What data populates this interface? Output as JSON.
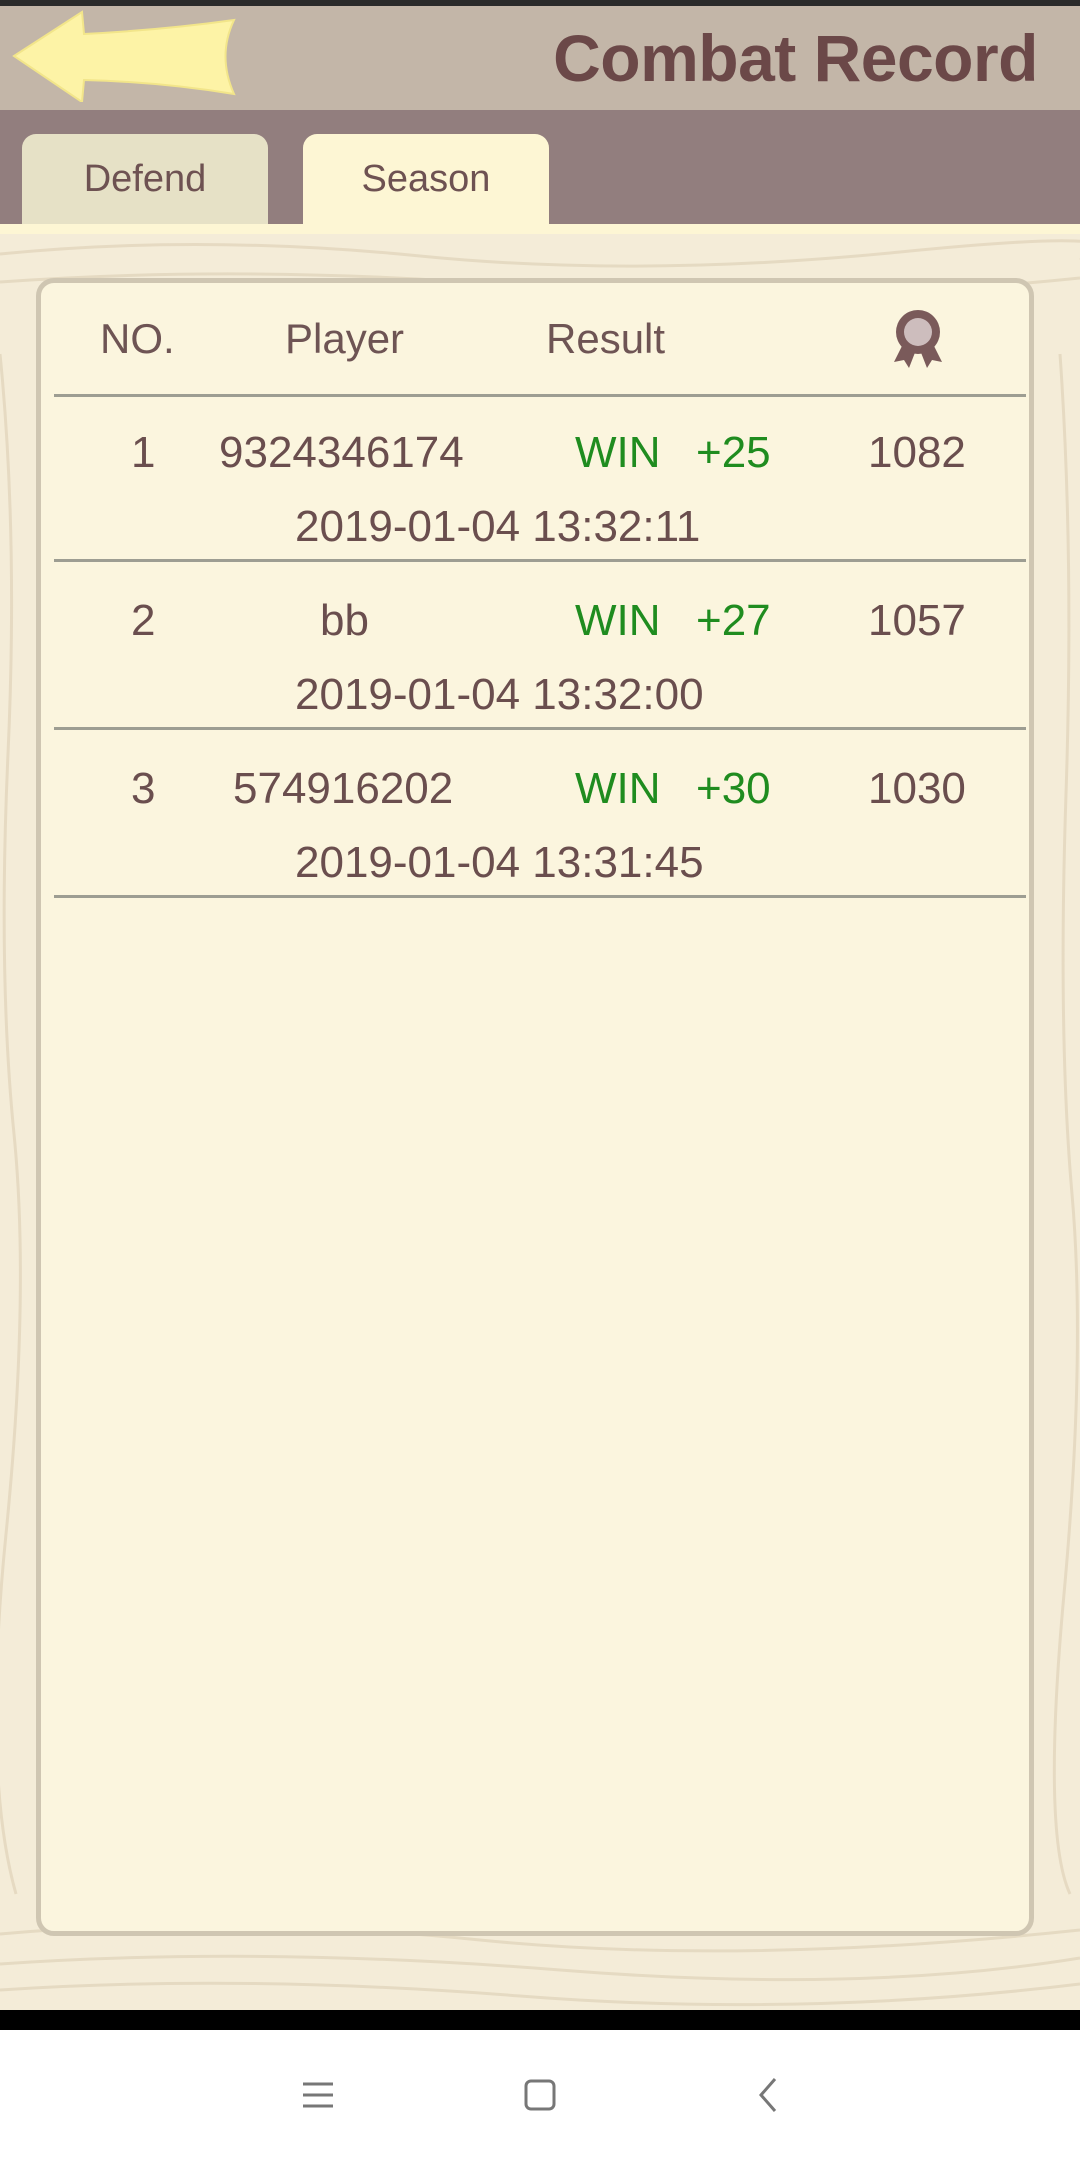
{
  "header": {
    "title": "Combat Record"
  },
  "tabs": [
    {
      "label": "Defend"
    },
    {
      "label": "Season"
    }
  ],
  "table": {
    "columns": [
      "NO.",
      "Player",
      "Result"
    ],
    "rank_column_icon": "medal-icon",
    "rows": [
      {
        "no": "1",
        "player": "9324346174",
        "result": "WIN",
        "delta": "+25",
        "score": "1082",
        "time": "2019-01-04 13:32:11"
      },
      {
        "no": "2",
        "player": "bb",
        "result": "WIN",
        "delta": "+27",
        "score": "1057",
        "time": "2019-01-04 13:32:00"
      },
      {
        "no": "3",
        "player": "574916202",
        "result": "WIN",
        "delta": "+30",
        "score": "1030",
        "time": "2019-01-04 13:31:45"
      }
    ]
  },
  "colors": {
    "title": "#6b4848",
    "win": "#1f8c1f",
    "tab_active": "#fdf6d4",
    "tab_inactive": "#e6e1c6",
    "tabbar": "#927e7e"
  },
  "system_nav": {
    "icons": [
      "menu-icon",
      "home-icon",
      "back-icon"
    ]
  }
}
